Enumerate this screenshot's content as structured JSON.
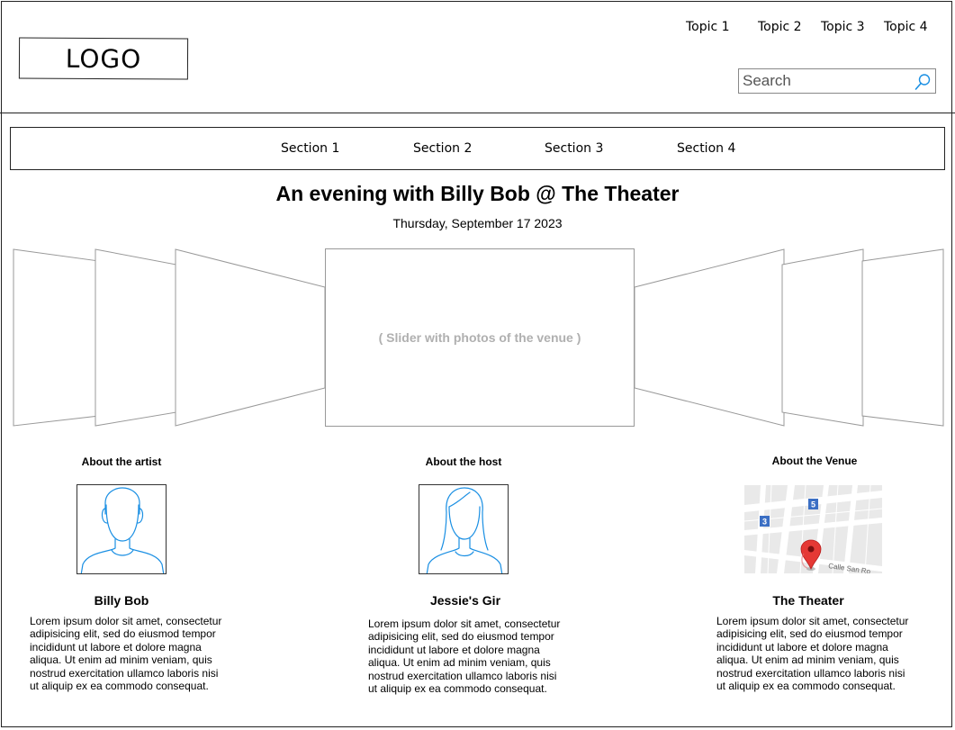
{
  "header": {
    "logo": "LOGO",
    "topics": [
      "Topic 1",
      "Topic 2",
      "Topic 3",
      "Topic 4"
    ],
    "search_placeholder": "Search"
  },
  "nav": {
    "sections": [
      "Section 1",
      "Section 2",
      "Section 3",
      "Section 4"
    ]
  },
  "event": {
    "title": "An evening with Billy Bob @ The Theater",
    "date": "Thursday, September 17 2023"
  },
  "slider": {
    "caption": "( Slider with photos of the venue )"
  },
  "columns": [
    {
      "heading": "About the artist",
      "name": "Billy Bob",
      "text": "Lorem ipsum dolor sit amet, consectetur adipisicing elit, sed do eiusmod tempor incididunt ut labore et dolore magna aliqua. Ut enim ad minim veniam, quis nostrud exercitation ullamco laboris nisi ut aliquip ex ea commodo consequat."
    },
    {
      "heading": "About the host",
      "name": "Jessie's Gir",
      "text": "Lorem ipsum dolor sit amet, consectetur adipisicing elit, sed do eiusmod tempor incididunt ut labore et dolore magna aliqua. Ut enim ad minim veniam, quis nostrud exercitation ullamco laboris nisi ut aliquip ex ea commodo consequat."
    },
    {
      "heading": "About the Venue",
      "name": "The Theater",
      "text": "Lorem ipsum dolor sit amet, consectetur adipisicing elit, sed do eiusmod tempor incididunt ut labore et dolore magna aliqua. Ut enim ad minim veniam, quis nostrud exercitation ullamco laboris nisi ut aliquip ex ea commodo consequat."
    }
  ],
  "map": {
    "street_label": "Calle San Ro",
    "markers": [
      "5",
      "3"
    ]
  },
  "colors": {
    "avatar_stroke": "#1a8fe3",
    "slider_caption": "#b0b0b0",
    "map_pin": "#e53935",
    "map_marker": "#3b6fc4"
  },
  "icons": {
    "search": "search-icon",
    "artist": "male-avatar-icon",
    "host": "female-avatar-icon",
    "venue": "map-icon",
    "pin": "map-pin-icon"
  }
}
